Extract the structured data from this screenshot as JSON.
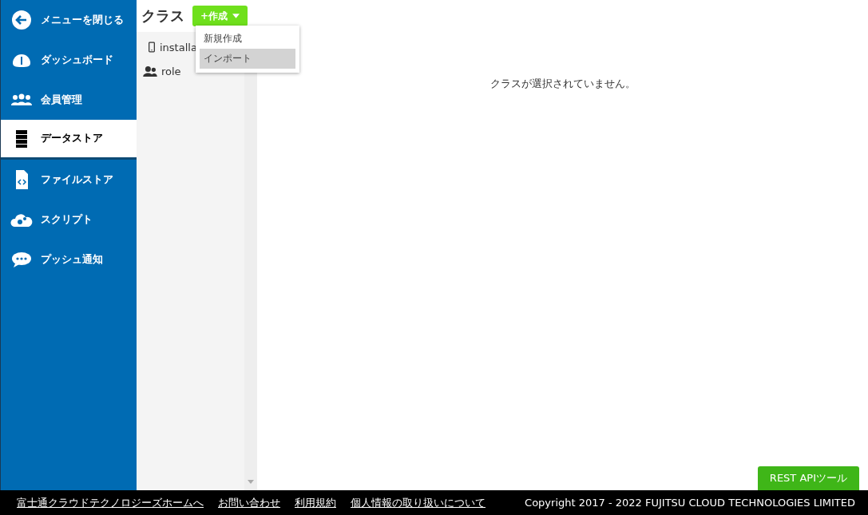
{
  "sidebar": {
    "items": [
      {
        "label": "メニューを閉じる",
        "kind": "back",
        "selected": false
      },
      {
        "label": "ダッシュボード",
        "kind": "gauge",
        "selected": false
      },
      {
        "label": "会員管理",
        "kind": "users",
        "selected": false
      },
      {
        "label": "データストア",
        "kind": "database",
        "selected": true
      },
      {
        "label": "ファイルストア",
        "kind": "file",
        "selected": false
      },
      {
        "label": "スクリプト",
        "kind": "cloud",
        "selected": false
      },
      {
        "label": "プッシュ通知",
        "kind": "chat",
        "selected": false
      }
    ]
  },
  "class_panel": {
    "title": "クラス",
    "create_button": "+作成",
    "classes": [
      {
        "name": "installa",
        "kind": "phone"
      },
      {
        "name": "role",
        "kind": "users"
      }
    ],
    "dropdown": [
      {
        "label": "新規作成",
        "selected": false
      },
      {
        "label": "インポート",
        "selected": true
      }
    ]
  },
  "main": {
    "message": "クラスが選択されていません。",
    "rest_button": "REST APIツール"
  },
  "footer": {
    "links": [
      "富士通クラウドテクノロジーズホームへ",
      "お問い合わせ",
      "利用規約",
      "個人情報の取り扱いについて"
    ],
    "copyright": "Copyright 2017 - 2022 FUJITSU CLOUD TECHNOLOGIES LIMITED"
  }
}
